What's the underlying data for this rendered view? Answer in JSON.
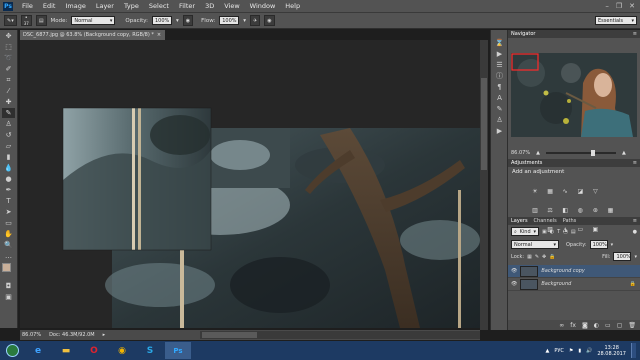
{
  "menubar": {
    "logo": "Ps",
    "items": [
      "File",
      "Edit",
      "Image",
      "Layer",
      "Type",
      "Select",
      "Filter",
      "3D",
      "View",
      "Window",
      "Help"
    ],
    "window_controls": [
      "–",
      "❐",
      "✕"
    ]
  },
  "options": {
    "brush_size": "37",
    "mode_label": "Mode:",
    "mode_value": "Normal",
    "opacity_label": "Opacity:",
    "opacity_value": "100%",
    "flow_label": "Flow:",
    "flow_value": "100%",
    "workspace": "Essentials"
  },
  "document": {
    "tab_title": "DSC_6877.jpg @ 63.8% (Background copy, RGB/8) *",
    "tab_close": "×"
  },
  "status": {
    "zoom": "86.07%",
    "doc_size": "Doc: 46.3M/92.0M"
  },
  "navigator": {
    "tabs": [
      "Navigator"
    ],
    "zoom": "86.07%"
  },
  "adjustments": {
    "tab": "Adjustments",
    "title": "Add an adjustment"
  },
  "layers": {
    "tabs": [
      "Layers",
      "Channels",
      "Paths"
    ],
    "kind": "Kind",
    "blend": "Normal",
    "opacity_label": "Opacity:",
    "opacity_value": "100%",
    "lock_label": "Lock:",
    "fill_label": "Fill:",
    "fill_value": "100%",
    "items": [
      {
        "name": "Background copy",
        "selected": true
      },
      {
        "name": "Background",
        "selected": false
      }
    ]
  },
  "taskbar": {
    "tray_lang": "РУС",
    "time": "13:28",
    "date": "28.08.2017"
  },
  "colors": {
    "ui_panel": "#535353",
    "canvas_bg": "#282828",
    "selected_layer": "#3f5877",
    "taskbar": "#1d3a63"
  }
}
